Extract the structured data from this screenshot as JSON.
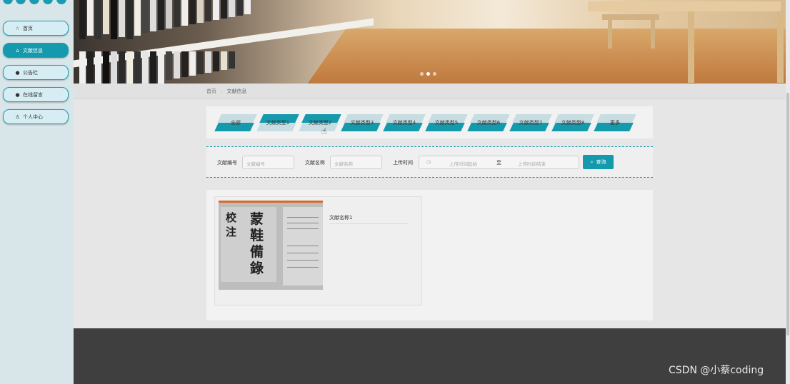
{
  "sidebar": {
    "items": [
      {
        "label": "首页",
        "icon": "star-icon"
      },
      {
        "label": "文献信息",
        "icon": "home-icon"
      },
      {
        "label": "公告栏",
        "icon": "info-icon"
      },
      {
        "label": "在线留言",
        "icon": "help-icon"
      },
      {
        "label": "个人中心",
        "icon": "user-icon"
      }
    ],
    "active_index": 1
  },
  "banner": {
    "slides": 3,
    "active_slide": 1
  },
  "breadcrumb": {
    "home": "首页",
    "separator": ":",
    "current": "文献信息"
  },
  "tabs": [
    "全部",
    "文献类型1",
    "文献类型2",
    "文献类型3",
    "文献类型4",
    "文献类型5",
    "文献类型6",
    "文献类型7",
    "文献类型8",
    "更多"
  ],
  "tabs_selected": [
    1,
    2
  ],
  "search": {
    "field1_label": "文献编号",
    "field1_placeholder": "文献编号",
    "field2_label": "文献名称",
    "field2_placeholder": "文献名称",
    "field3_label": "上传时间",
    "date_start_placeholder": "上传时间起始",
    "date_separator": "至",
    "date_end_placeholder": "上传时间结束",
    "button_label": "查询"
  },
  "results": [
    {
      "title": "文献名称1",
      "image_text": [
        "蒙",
        "鞋",
        "備",
        "錄",
        "校",
        "注"
      ]
    }
  ],
  "watermark": "CSDN @小蔡coding",
  "colors": {
    "accent": "#1599ad",
    "footer": "#3f3f3f"
  }
}
